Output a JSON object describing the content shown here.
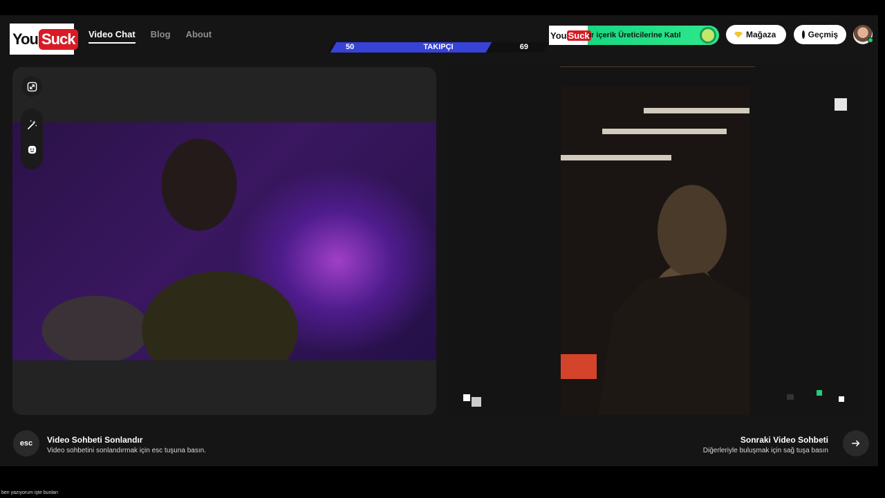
{
  "header": {
    "logo": {
      "you": "You",
      "suck": "Suck"
    },
    "nav": [
      {
        "label": "Video Chat",
        "active": true
      },
      {
        "label": "Blog",
        "active": false
      },
      {
        "label": "About",
        "active": false
      }
    ],
    "followers": {
      "current": "50",
      "label": "TAKIPÇI",
      "target": "69",
      "progress": 0.72
    },
    "promo": {
      "logo_you": "You",
      "logo_suck": "Suck",
      "text": "ır içerik Üreticilerine Katıl"
    },
    "shop_label": "Mağaza",
    "history_label": "Geçmiş"
  },
  "bottom": {
    "end": {
      "key": "esc",
      "title": "Video Sohbeti Sonlandır",
      "subtitle": "Video sohbetini sonlandırmak için esc tuşuna basın."
    },
    "next": {
      "title": "Sonraki Video Sohbeti",
      "subtitle": "Diğerleriyle buluşmak için sağ tuşa basın"
    }
  },
  "caption": "ben yazıyorum işte bunları",
  "icons": [
    "expand-icon",
    "magic-wand-icon",
    "emoji-icon",
    "arrow-right-icon",
    "gem-icon",
    "clock-icon"
  ],
  "colors": {
    "accent_green": "#20d07a",
    "brand_red": "#d81b25",
    "follower_blue": "#3742d6"
  }
}
